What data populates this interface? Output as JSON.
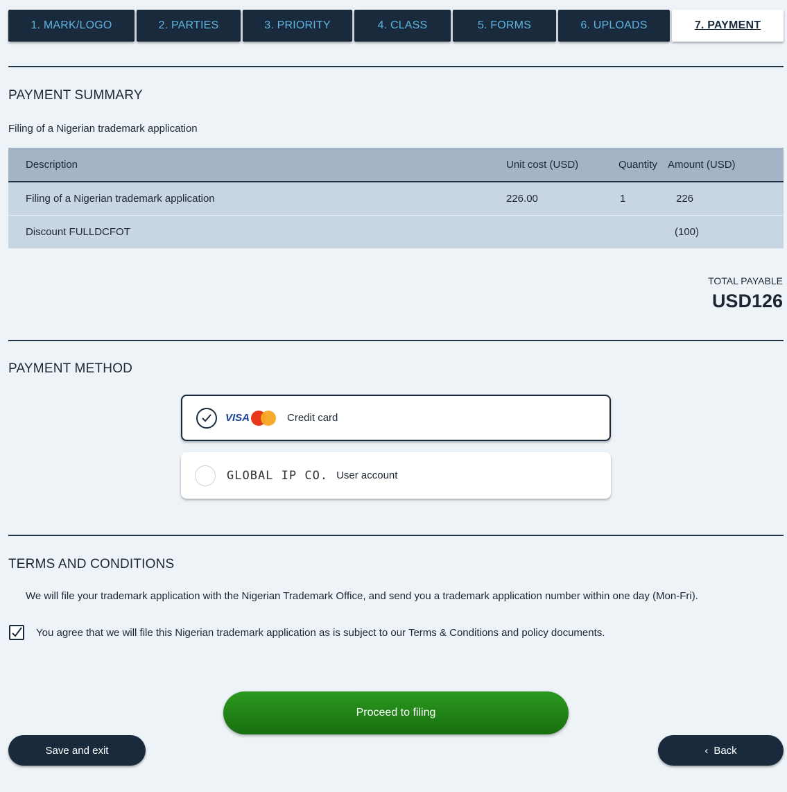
{
  "tabs": [
    {
      "label": "1. MARK/LOGO"
    },
    {
      "label": "2. PARTIES"
    },
    {
      "label": "3. PRIORITY"
    },
    {
      "label": "4. CLASS"
    },
    {
      "label": "5. FORMS"
    },
    {
      "label": "6. UPLOADS"
    },
    {
      "label": "7. PAYMENT"
    }
  ],
  "active_tab": "7. PAYMENT",
  "summary": {
    "title": "PAYMENT SUMMARY",
    "subtitle": "Filing of a Nigerian trademark application",
    "headers": [
      "Description",
      "Unit cost (USD)",
      "Quantity",
      "Amount (USD)"
    ],
    "rows": [
      [
        "Filing of a Nigerian trademark application",
        "226.00",
        "1",
        "226"
      ],
      [
        "Discount FULLDCFOT",
        "",
        "",
        "(100)"
      ]
    ],
    "total_label": "TOTAL PAYABLE",
    "total_value": "USD126"
  },
  "payment_method": {
    "title": "PAYMENT METHOD",
    "options": [
      {
        "brand": "VISA",
        "label": "Credit card",
        "selected": true
      },
      {
        "brand": "GLOBAL IP CO.",
        "label": "User account",
        "selected": false
      }
    ]
  },
  "terms": {
    "title": "TERMS AND CONDITIONS",
    "text": "We will file your trademark application with the Nigerian Trademark Office, and send you a trademark application number within one day (Mon-Fri).",
    "agree_text": "You agree that we will file this Nigerian trademark application as is subject to our Terms & Conditions and policy documents.",
    "agreed": true
  },
  "buttons": {
    "proceed": "Proceed to filing",
    "save_exit": "Save and exit",
    "back": "Back"
  },
  "colors": {
    "navy": "#1a2a3d",
    "tab_text": "#5fb4e0",
    "proceed_green": "#218a17",
    "table_header": "#a3b4c6",
    "table_row": "#c8d5e2"
  }
}
